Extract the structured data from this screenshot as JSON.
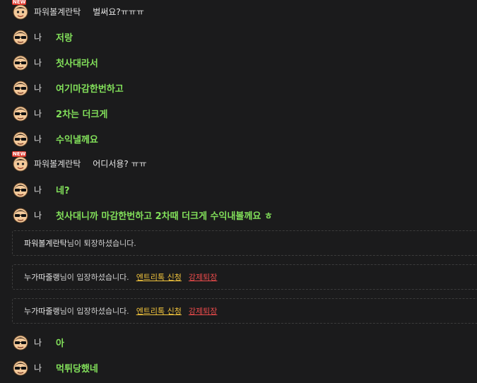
{
  "colors": {
    "background": "#1b1b1c",
    "my_message": "#82e05a",
    "entry_link": "#f0c33c",
    "kick_link": "#ec4b4b"
  },
  "new_badge": "NEW",
  "messages": [
    {
      "sender": "파워볼계란탁",
      "text": "벌써요?ㅠㅠㅠ",
      "mine": false,
      "avatar": "new-user-avatar-icon"
    },
    {
      "sender": "나",
      "text": "저랑",
      "mine": true,
      "avatar": "my-avatar-icon"
    },
    {
      "sender": "나",
      "text": "첫사대라서",
      "mine": true,
      "avatar": "my-avatar-icon"
    },
    {
      "sender": "나",
      "text": "여기마감한번하고",
      "mine": true,
      "avatar": "my-avatar-icon"
    },
    {
      "sender": "나",
      "text": "2차는 더크게",
      "mine": true,
      "avatar": "my-avatar-icon"
    },
    {
      "sender": "나",
      "text": "수익낼께요",
      "mine": true,
      "avatar": "my-avatar-icon"
    },
    {
      "sender": "파워볼계란탁",
      "text": "어디서용? ㅠㅠ",
      "mine": false,
      "avatar": "new-user-avatar-icon"
    },
    {
      "sender": "나",
      "text": "네?",
      "mine": true,
      "avatar": "my-avatar-icon"
    },
    {
      "sender": "나",
      "text": "첫사대니까 마감한번하고 2차때 더크게 수익내볼께요 ㅎ",
      "mine": true,
      "avatar": "my-avatar-icon"
    }
  ],
  "notices": [
    {
      "user": "파워볼계란탁",
      "text": "님이 퇴장하셨습니다.",
      "entry_link": "",
      "kick_link": ""
    },
    {
      "user": "누가따줄랭",
      "text": "님이 입장하셨습니다.",
      "entry_link": "엔트리톡 신청",
      "kick_link": "강제퇴장"
    },
    {
      "user": "누가따줄랭",
      "text": "님이 입장하셨습니다.",
      "entry_link": "엔트리톡 신청",
      "kick_link": "강제퇴장"
    }
  ],
  "messages_after": [
    {
      "sender": "나",
      "text": "아",
      "mine": true,
      "avatar": "my-avatar-icon"
    },
    {
      "sender": "나",
      "text": "먹튀당했네",
      "mine": true,
      "avatar": "my-avatar-icon"
    }
  ]
}
